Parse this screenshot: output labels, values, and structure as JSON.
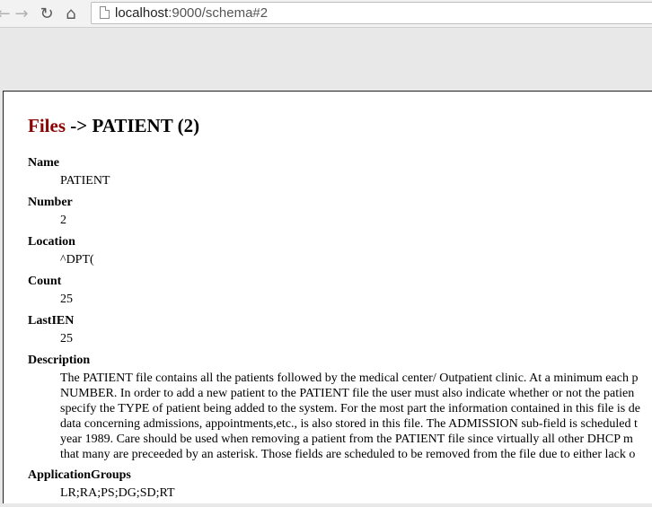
{
  "browser": {
    "url_host": "localhost",
    "url_rest": ":9000/schema#2",
    "back_glyph": "←",
    "forward_glyph": "→",
    "reload_glyph": "↻",
    "home_glyph": "⌂"
  },
  "page": {
    "title_link": "Files",
    "title_sep": " -> ",
    "title_rest": "PATIENT (2)"
  },
  "fields": [
    {
      "label": "Name",
      "value": "PATIENT"
    },
    {
      "label": "Number",
      "value": "2"
    },
    {
      "label": "Location",
      "value": "^DPT("
    },
    {
      "label": "Count",
      "value": "25"
    },
    {
      "label": "LastIEN",
      "value": "25"
    }
  ],
  "description": {
    "label": "Description",
    "lines": [
      "The PATIENT file contains all the patients followed by the medical center/ Outpatient clinic. At a minimum each p",
      "NUMBER. In order to add a new patient to the PATIENT file the user must also indicate whether or not the patien",
      "specify the TYPE of patient being added to the system. For the most part the information contained in this file is de",
      "data concerning admissions, appointments,etc., is also stored in this file. The ADMISSION sub-field is scheduled t",
      "year 1989. Care should be used when removing a patient from the PATIENT file since virtually all other DHCP m",
      "that many are preceeded by an asterisk. Those fields are scheduled to be removed from the file due to either lack o"
    ]
  },
  "application_groups": {
    "label": "ApplicationGroups",
    "value": "LR;RA;PS;DG;SD;RT"
  }
}
